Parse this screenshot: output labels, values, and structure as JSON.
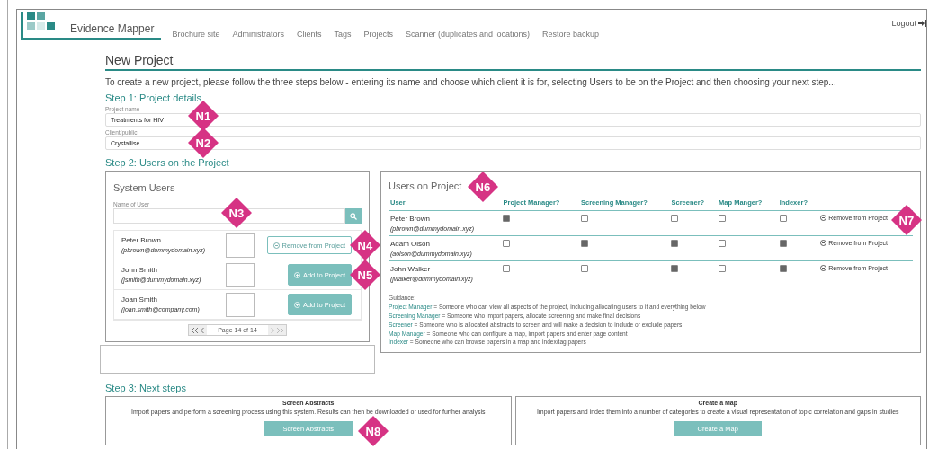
{
  "nav": {
    "brand": "Evidence Mapper",
    "links": [
      "Brochure site",
      "Administrators",
      "Clients",
      "Tags",
      "Projects",
      "Scanner (duplicates and locations)",
      "Restore backup"
    ],
    "logout": "Logout"
  },
  "page_title": "New Project",
  "intro": "To create a new project, please follow the three steps below - entering its name and choose which client it is for, selecting Users to be on the Project and then choosing your next step...",
  "step1": {
    "heading": "Step 1: Project details",
    "fields": [
      {
        "label": "Project name",
        "value": "Treatments for HIV",
        "marker": "N1"
      },
      {
        "label": "Client/public",
        "value": "Crystallise",
        "marker": "N2"
      }
    ]
  },
  "step2": {
    "heading": "Step 2: Users on the Project",
    "system_users": {
      "title": "System Users",
      "search_label": "Name of User",
      "search_marker": "N3",
      "users": [
        {
          "name": "Peter Brown",
          "email": "(pbrown@dummydomain.xyz)",
          "on_project": true,
          "action": "Remove from Project",
          "marker": "N4"
        },
        {
          "name": "John Smith",
          "email": "(jsmith@dummydomain.xyz)",
          "on_project": false,
          "action": "Add to Project",
          "marker": "N5"
        },
        {
          "name": "Joan Smith",
          "email": "(joan.smith@company.com)",
          "on_project": false,
          "action": "Add to Project"
        }
      ],
      "pager": "Page 14 of 14"
    },
    "users_on_project": {
      "title": "Users on Project",
      "marker": "N6",
      "columns": [
        "User",
        "Project Manager?",
        "Screening Manager?",
        "Screener?",
        "Map Manger?",
        "Indexer?"
      ],
      "rows": [
        {
          "name": "Peter Brown",
          "email": "(pbrown@dummydomain.xyz)",
          "roles": [
            true,
            false,
            false,
            false,
            false
          ],
          "action": "Remove from Project",
          "marker": "N7"
        },
        {
          "name": "Adam Olson",
          "email": "(aolson@dummydomain.xyz)",
          "roles": [
            false,
            true,
            true,
            false,
            true
          ],
          "action": "Remove from Project"
        },
        {
          "name": "John Walker",
          "email": "(jwalker@dummydomain.xyz)",
          "roles": [
            false,
            false,
            true,
            false,
            true
          ],
          "action": "Remove from Project"
        }
      ],
      "guidance": {
        "title": "Guidance:",
        "items": [
          {
            "term": "Project Manager",
            "text": "= Someone who can view all aspects of the project, including allocating users to it and everything below"
          },
          {
            "term": "Screening Manager",
            "text": "= Someone who import papers, allocate screening and make final decisions"
          },
          {
            "term": "Screener",
            "text": "= Someone who is allocated abstracts to screen and will make a decision to include or exclude papers"
          },
          {
            "term": "Map Manager",
            "text": "= Someone who can configure a map, import papers and enter page content"
          },
          {
            "term": "Indexer",
            "text": "= Someone who can browse papers in a map and index/tag papers"
          }
        ]
      }
    }
  },
  "step3": {
    "heading": "Step 3: Next steps",
    "options": [
      {
        "title": "Screen Abstracts",
        "description": "Import papers and perform a screening process using this system. Results can then be downloaded or used for further analysis",
        "button": "Screen Abstracts",
        "marker": "N8"
      },
      {
        "title": "Create a Map",
        "description": "Import papers and index them into a number of categories to create a visual representation of topic correlation and gaps in studies",
        "button": "Create a Map"
      }
    ]
  }
}
